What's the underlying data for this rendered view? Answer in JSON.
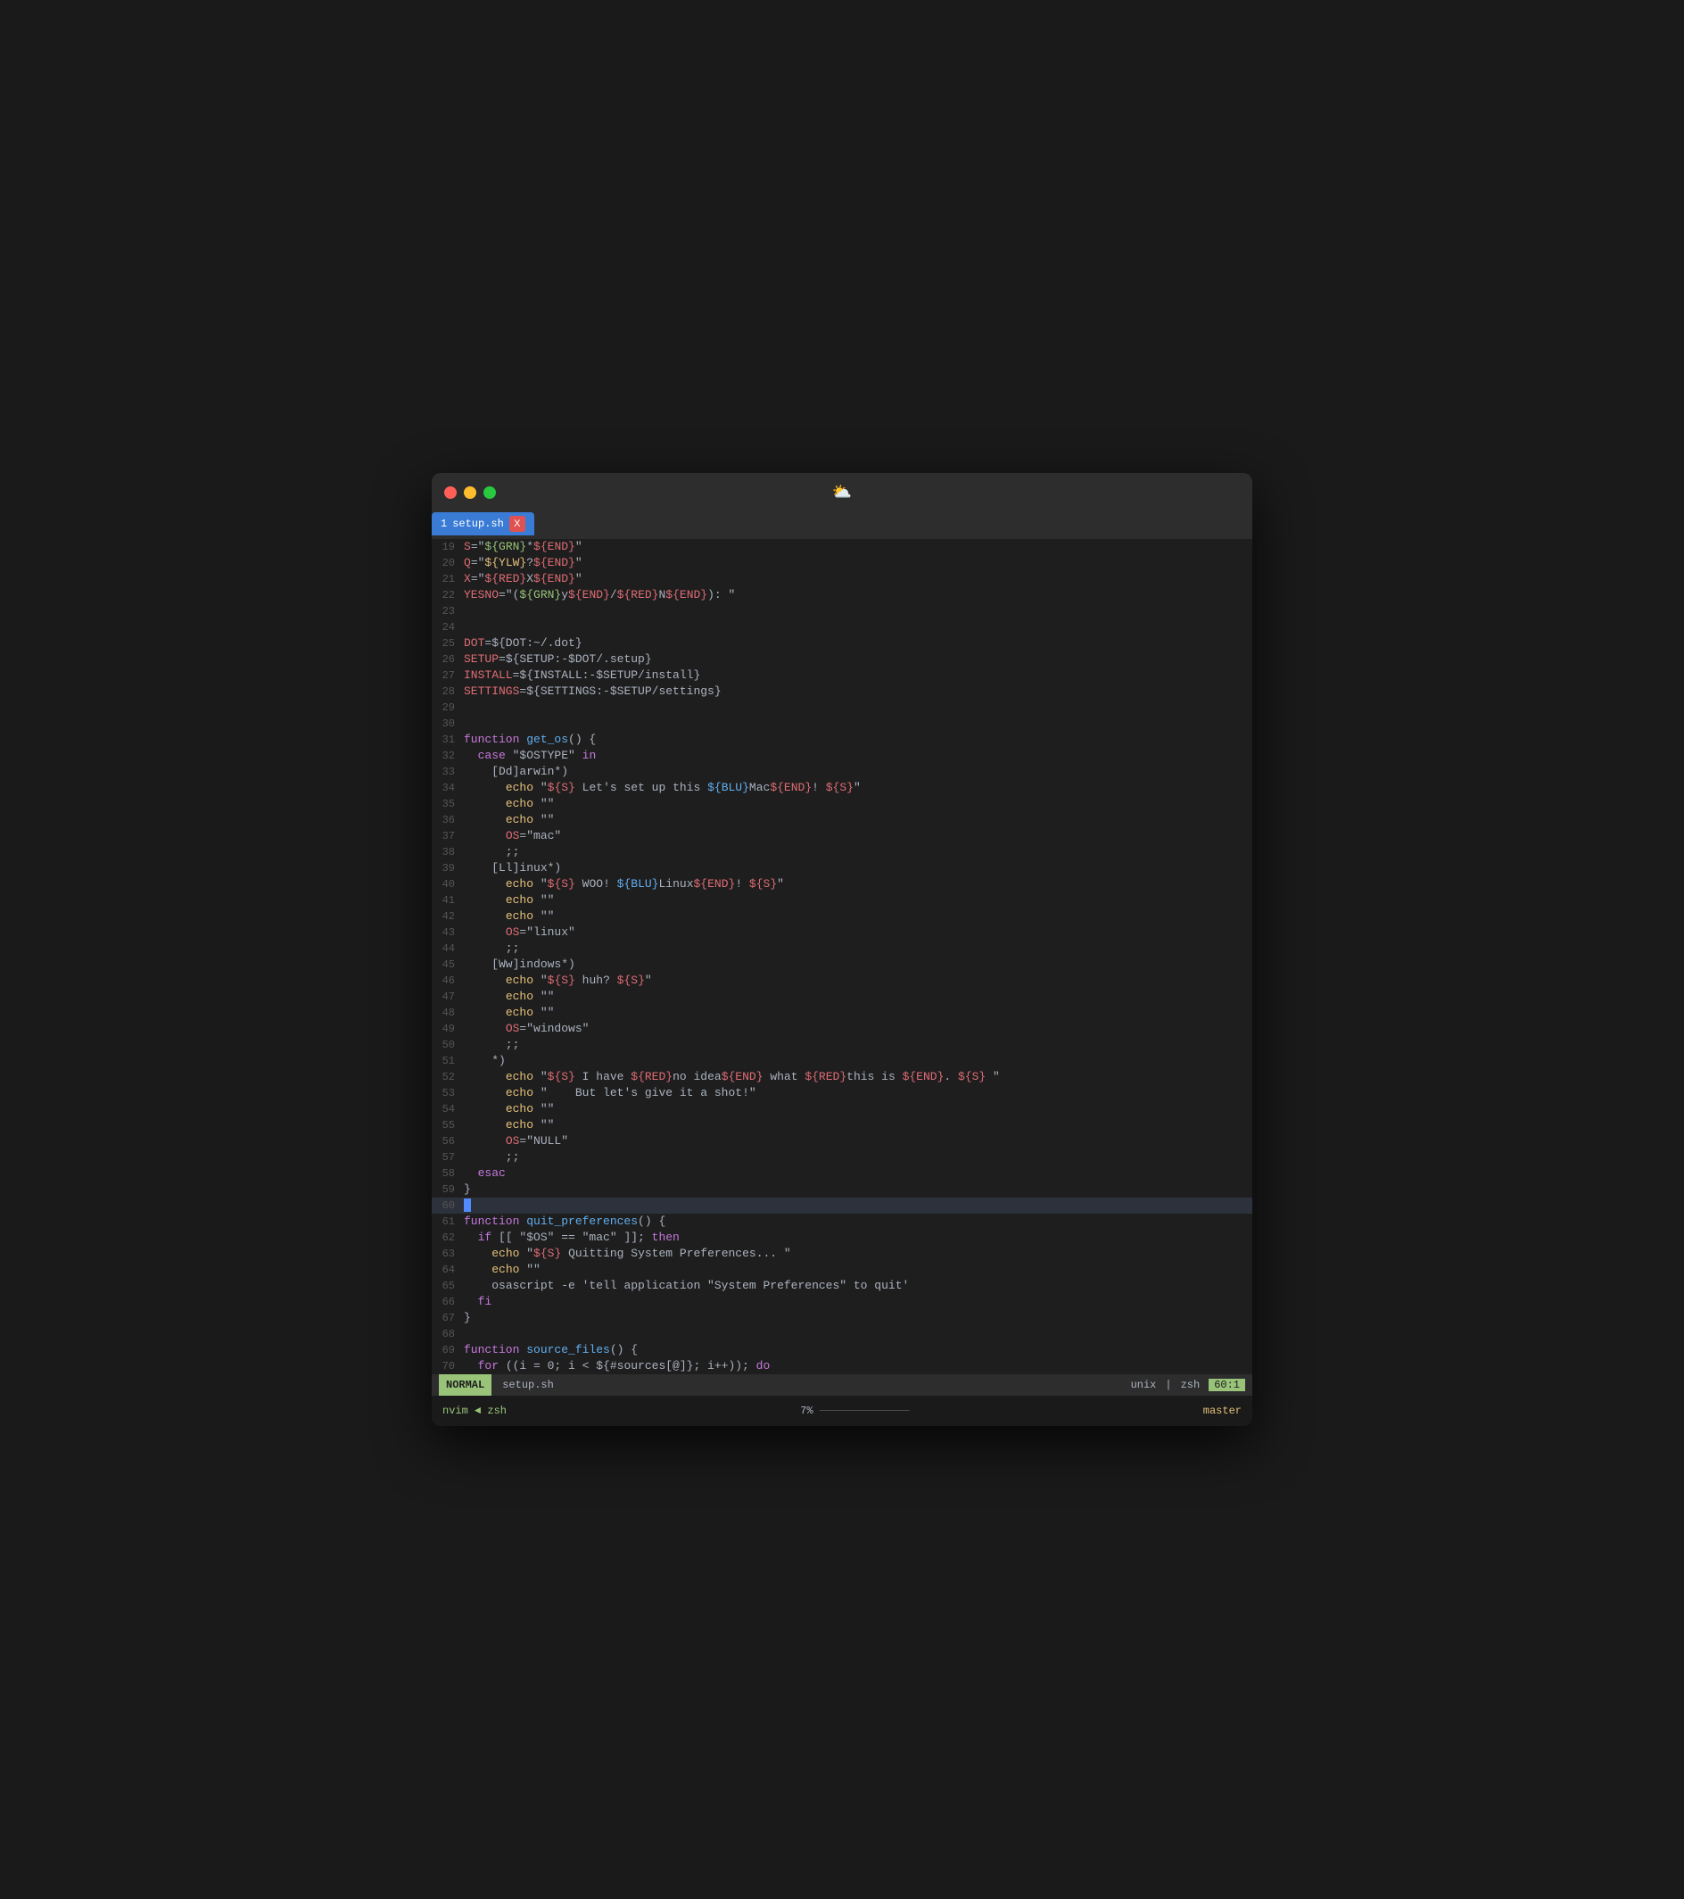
{
  "window": {
    "titlebar": {
      "icon": "☁️",
      "traffic_lights": [
        "close",
        "minimize",
        "maximize"
      ]
    },
    "tab": {
      "number": "1",
      "filename": "setup.sh",
      "close_label": "X"
    }
  },
  "editor": {
    "lines": [
      {
        "num": "19",
        "tokens": [
          {
            "t": "var",
            "v": "S"
          },
          {
            "t": "norm",
            "v": "=\""
          },
          {
            "t": "grn",
            "v": "${GRN}"
          },
          {
            "t": "norm",
            "v": "*"
          },
          {
            "t": "var",
            "v": "${END}"
          },
          {
            "t": "norm",
            "v": "\""
          }
        ]
      },
      {
        "num": "20",
        "tokens": [
          {
            "t": "var",
            "v": "Q"
          },
          {
            "t": "norm",
            "v": "=\""
          },
          {
            "t": "yel",
            "v": "${YLW}"
          },
          {
            "t": "norm",
            "v": "?"
          },
          {
            "t": "var",
            "v": "${END}"
          },
          {
            "t": "norm",
            "v": "\""
          }
        ]
      },
      {
        "num": "21",
        "tokens": [
          {
            "t": "var",
            "v": "X"
          },
          {
            "t": "norm",
            "v": "=\""
          },
          {
            "t": "var",
            "v": "${RED}"
          },
          {
            "t": "norm",
            "v": "X"
          },
          {
            "t": "var",
            "v": "${END}"
          },
          {
            "t": "norm",
            "v": "\""
          }
        ]
      },
      {
        "num": "22",
        "tokens": [
          {
            "t": "var",
            "v": "YESNO"
          },
          {
            "t": "norm",
            "v": "=\"("
          },
          {
            "t": "grn",
            "v": "${GRN}"
          },
          {
            "t": "norm",
            "v": "y"
          },
          {
            "t": "var",
            "v": "${END}"
          },
          {
            "t": "norm",
            "v": "/"
          },
          {
            "t": "var",
            "v": "${RED}"
          },
          {
            "t": "norm",
            "v": "N"
          },
          {
            "t": "var",
            "v": "${END}"
          },
          {
            "t": "norm",
            "v": "): \""
          }
        ]
      },
      {
        "num": "23",
        "tokens": []
      },
      {
        "num": "24",
        "tokens": []
      },
      {
        "num": "25",
        "tokens": [
          {
            "t": "var",
            "v": "DOT"
          },
          {
            "t": "norm",
            "v": "=${DOT:~/.dot}"
          }
        ]
      },
      {
        "num": "26",
        "tokens": [
          {
            "t": "var",
            "v": "SETUP"
          },
          {
            "t": "norm",
            "v": "=${SETUP:-$DOT/.setup}"
          }
        ]
      },
      {
        "num": "27",
        "tokens": [
          {
            "t": "var",
            "v": "INSTALL"
          },
          {
            "t": "norm",
            "v": "=${INSTALL:-$SETUP/install}"
          }
        ]
      },
      {
        "num": "28",
        "tokens": [
          {
            "t": "var",
            "v": "SETTINGS"
          },
          {
            "t": "norm",
            "v": "=${SETTINGS:-$SETUP/settings}"
          }
        ]
      },
      {
        "num": "29",
        "tokens": []
      },
      {
        "num": "30",
        "tokens": []
      },
      {
        "num": "31",
        "tokens": [
          {
            "t": "kw",
            "v": "function "
          },
          {
            "t": "fn",
            "v": "get_os"
          },
          {
            "t": "norm",
            "v": "() {"
          }
        ]
      },
      {
        "num": "32",
        "tokens": [
          {
            "t": "norm",
            "v": "  "
          },
          {
            "t": "kw",
            "v": "case"
          },
          {
            "t": "norm",
            "v": " \"$OSTYPE\" "
          },
          {
            "t": "kw",
            "v": "in"
          }
        ]
      },
      {
        "num": "33",
        "tokens": [
          {
            "t": "norm",
            "v": "    [Dd]arwin*)"
          }
        ]
      },
      {
        "num": "34",
        "tokens": [
          {
            "t": "norm",
            "v": "      "
          },
          {
            "t": "cmd",
            "v": "echo"
          },
          {
            "t": "norm",
            "v": " \""
          },
          {
            "t": "var",
            "v": "${S}"
          },
          {
            "t": "norm",
            "v": " Let's set up this "
          },
          {
            "t": "blu",
            "v": "${BLU}"
          },
          {
            "t": "norm",
            "v": "Mac"
          },
          {
            "t": "var",
            "v": "${END}"
          },
          {
            "t": "norm",
            "v": "! "
          },
          {
            "t": "var",
            "v": "${S}"
          },
          {
            "t": "norm",
            "v": "\""
          }
        ]
      },
      {
        "num": "35",
        "tokens": [
          {
            "t": "norm",
            "v": "      "
          },
          {
            "t": "cmd",
            "v": "echo"
          },
          {
            "t": "norm",
            "v": " \"\""
          }
        ]
      },
      {
        "num": "36",
        "tokens": [
          {
            "t": "norm",
            "v": "      "
          },
          {
            "t": "cmd",
            "v": "echo"
          },
          {
            "t": "norm",
            "v": " \"\""
          }
        ]
      },
      {
        "num": "37",
        "tokens": [
          {
            "t": "norm",
            "v": "      "
          },
          {
            "t": "var",
            "v": "OS"
          },
          {
            "t": "norm",
            "v": "=\"mac\""
          }
        ]
      },
      {
        "num": "38",
        "tokens": [
          {
            "t": "norm",
            "v": "      ;;"
          }
        ]
      },
      {
        "num": "39",
        "tokens": [
          {
            "t": "norm",
            "v": "    [Ll]inux*)"
          }
        ]
      },
      {
        "num": "40",
        "tokens": [
          {
            "t": "norm",
            "v": "      "
          },
          {
            "t": "cmd",
            "v": "echo"
          },
          {
            "t": "norm",
            "v": " \""
          },
          {
            "t": "var",
            "v": "${S}"
          },
          {
            "t": "norm",
            "v": " WOO! "
          },
          {
            "t": "blu",
            "v": "${BLU}"
          },
          {
            "t": "norm",
            "v": "Linux"
          },
          {
            "t": "var",
            "v": "${END}"
          },
          {
            "t": "norm",
            "v": "! "
          },
          {
            "t": "var",
            "v": "${S}"
          },
          {
            "t": "norm",
            "v": "\""
          }
        ]
      },
      {
        "num": "41",
        "tokens": [
          {
            "t": "norm",
            "v": "      "
          },
          {
            "t": "cmd",
            "v": "echo"
          },
          {
            "t": "norm",
            "v": " \"\""
          }
        ]
      },
      {
        "num": "42",
        "tokens": [
          {
            "t": "norm",
            "v": "      "
          },
          {
            "t": "cmd",
            "v": "echo"
          },
          {
            "t": "norm",
            "v": " \"\""
          }
        ]
      },
      {
        "num": "43",
        "tokens": [
          {
            "t": "norm",
            "v": "      "
          },
          {
            "t": "var",
            "v": "OS"
          },
          {
            "t": "norm",
            "v": "=\"linux\""
          }
        ]
      },
      {
        "num": "44",
        "tokens": [
          {
            "t": "norm",
            "v": "      ;;"
          }
        ]
      },
      {
        "num": "45",
        "tokens": [
          {
            "t": "norm",
            "v": "    [Ww]indows*)"
          }
        ]
      },
      {
        "num": "46",
        "tokens": [
          {
            "t": "norm",
            "v": "      "
          },
          {
            "t": "cmd",
            "v": "echo"
          },
          {
            "t": "norm",
            "v": " \""
          },
          {
            "t": "var",
            "v": "${S}"
          },
          {
            "t": "norm",
            "v": " huh? "
          },
          {
            "t": "var",
            "v": "${S}"
          },
          {
            "t": "norm",
            "v": "\""
          }
        ]
      },
      {
        "num": "47",
        "tokens": [
          {
            "t": "norm",
            "v": "      "
          },
          {
            "t": "cmd",
            "v": "echo"
          },
          {
            "t": "norm",
            "v": " \"\""
          }
        ]
      },
      {
        "num": "48",
        "tokens": [
          {
            "t": "norm",
            "v": "      "
          },
          {
            "t": "cmd",
            "v": "echo"
          },
          {
            "t": "norm",
            "v": " \"\""
          }
        ]
      },
      {
        "num": "49",
        "tokens": [
          {
            "t": "norm",
            "v": "      "
          },
          {
            "t": "var",
            "v": "OS"
          },
          {
            "t": "norm",
            "v": "=\"windows\""
          }
        ]
      },
      {
        "num": "50",
        "tokens": [
          {
            "t": "norm",
            "v": "      ;;"
          }
        ]
      },
      {
        "num": "51",
        "tokens": [
          {
            "t": "norm",
            "v": "    *)"
          }
        ]
      },
      {
        "num": "52",
        "tokens": [
          {
            "t": "norm",
            "v": "      "
          },
          {
            "t": "cmd",
            "v": "echo"
          },
          {
            "t": "norm",
            "v": " \""
          },
          {
            "t": "var",
            "v": "${S}"
          },
          {
            "t": "norm",
            "v": " I have "
          },
          {
            "t": "var",
            "v": "${RED}"
          },
          {
            "t": "norm",
            "v": "no idea"
          },
          {
            "t": "var",
            "v": "${END}"
          },
          {
            "t": "norm",
            "v": " what "
          },
          {
            "t": "var",
            "v": "${RED}"
          },
          {
            "t": "norm",
            "v": "this is "
          },
          {
            "t": "var",
            "v": "${END}"
          },
          {
            "t": "norm",
            "v": ". "
          },
          {
            "t": "var",
            "v": "${S}"
          },
          {
            "t": "norm",
            "v": " \""
          }
        ]
      },
      {
        "num": "53",
        "tokens": [
          {
            "t": "norm",
            "v": "      "
          },
          {
            "t": "cmd",
            "v": "echo"
          },
          {
            "t": "norm",
            "v": " \"    But let's give it a shot!\""
          }
        ]
      },
      {
        "num": "54",
        "tokens": [
          {
            "t": "norm",
            "v": "      "
          },
          {
            "t": "cmd",
            "v": "echo"
          },
          {
            "t": "norm",
            "v": " \"\""
          }
        ]
      },
      {
        "num": "55",
        "tokens": [
          {
            "t": "norm",
            "v": "      "
          },
          {
            "t": "cmd",
            "v": "echo"
          },
          {
            "t": "norm",
            "v": " \"\""
          }
        ]
      },
      {
        "num": "56",
        "tokens": [
          {
            "t": "norm",
            "v": "      "
          },
          {
            "t": "var",
            "v": "OS"
          },
          {
            "t": "norm",
            "v": "=\"NULL\""
          }
        ]
      },
      {
        "num": "57",
        "tokens": [
          {
            "t": "norm",
            "v": "      ;;"
          }
        ]
      },
      {
        "num": "58",
        "tokens": [
          {
            "t": "norm",
            "v": "  "
          },
          {
            "t": "kw",
            "v": "esac"
          }
        ]
      },
      {
        "num": "59",
        "tokens": [
          {
            "t": "norm",
            "v": "}"
          }
        ]
      },
      {
        "num": "60",
        "cursor": true,
        "tokens": []
      },
      {
        "num": "61",
        "tokens": [
          {
            "t": "kw",
            "v": "function "
          },
          {
            "t": "fn",
            "v": "quit_preferences"
          },
          {
            "t": "norm",
            "v": "() {"
          }
        ]
      },
      {
        "num": "62",
        "tokens": [
          {
            "t": "norm",
            "v": "  "
          },
          {
            "t": "kw",
            "v": "if"
          },
          {
            "t": "norm",
            "v": " [[ \"$OS\" == \"mac\" ]]; "
          },
          {
            "t": "kw",
            "v": "then"
          }
        ]
      },
      {
        "num": "63",
        "tokens": [
          {
            "t": "norm",
            "v": "    "
          },
          {
            "t": "cmd",
            "v": "echo"
          },
          {
            "t": "norm",
            "v": " \""
          },
          {
            "t": "var",
            "v": "${S}"
          },
          {
            "t": "norm",
            "v": " Quitting System Preferences... \""
          }
        ]
      },
      {
        "num": "64",
        "tokens": [
          {
            "t": "norm",
            "v": "    "
          },
          {
            "t": "cmd",
            "v": "echo"
          },
          {
            "t": "norm",
            "v": " \"\""
          }
        ]
      },
      {
        "num": "65",
        "tokens": [
          {
            "t": "norm",
            "v": "    "
          },
          {
            "t": "norm",
            "v": "osascript -e 'tell application \"System Preferences\" to quit'"
          }
        ]
      },
      {
        "num": "66",
        "tokens": [
          {
            "t": "norm",
            "v": "  "
          },
          {
            "t": "kw",
            "v": "fi"
          }
        ]
      },
      {
        "num": "67",
        "tokens": [
          {
            "t": "norm",
            "v": "}"
          }
        ]
      },
      {
        "num": "68",
        "tokens": []
      },
      {
        "num": "69",
        "tokens": [
          {
            "t": "kw",
            "v": "function "
          },
          {
            "t": "fn",
            "v": "source_files"
          },
          {
            "t": "norm",
            "v": "() {"
          }
        ]
      },
      {
        "num": "70",
        "tokens": [
          {
            "t": "norm",
            "v": "  "
          },
          {
            "t": "kw",
            "v": "for"
          },
          {
            "t": "norm",
            "v": " ((i = 0; i < ${#sources[@]}; i++)); "
          },
          {
            "t": "kw",
            "v": "do"
          }
        ]
      }
    ]
  },
  "statusbar": {
    "mode": "NORMAL",
    "filename": "setup.sh",
    "unix_label": "unix",
    "shell_label": "zsh",
    "position": "60:1"
  },
  "tmux": {
    "left": "nvim ◄ zsh",
    "percent": "7%",
    "branch": " master"
  }
}
